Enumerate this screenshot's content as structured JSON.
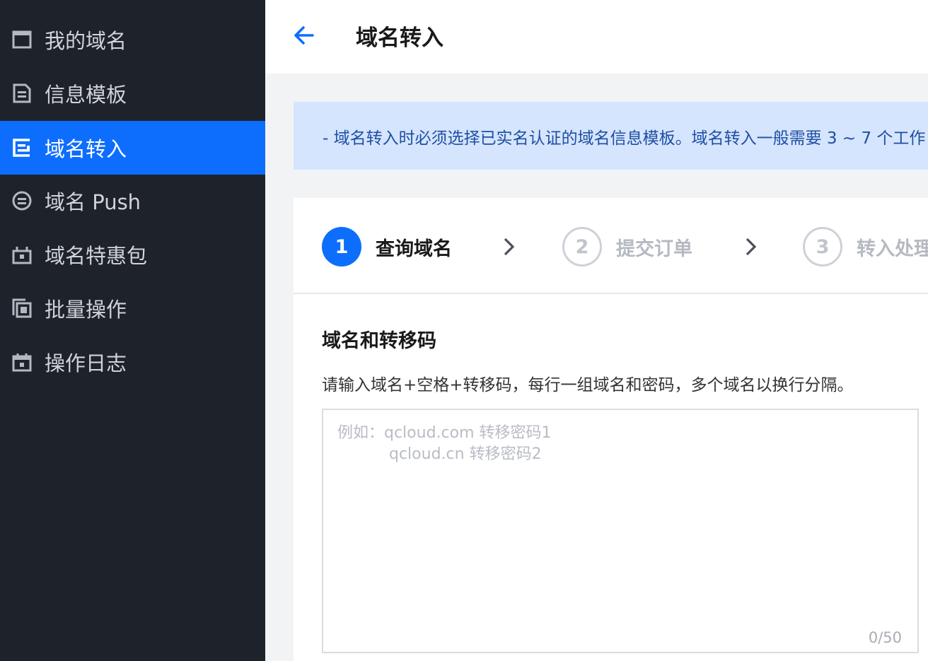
{
  "sidebar": {
    "items": [
      {
        "label": "我的域名",
        "icon": "browser-window-icon",
        "active": false
      },
      {
        "label": "信息模板",
        "icon": "document-icon",
        "active": false
      },
      {
        "label": "域名转入",
        "icon": "transfer-in-icon",
        "active": true
      },
      {
        "label": "域名 Push",
        "icon": "push-circle-icon",
        "active": false
      },
      {
        "label": "域名特惠包",
        "icon": "gift-package-icon",
        "active": false
      },
      {
        "label": "批量操作",
        "icon": "stacked-copies-icon",
        "active": false
      },
      {
        "label": "操作日志",
        "icon": "calendar-log-icon",
        "active": false
      }
    ]
  },
  "header": {
    "back_icon": "arrow-left-icon",
    "title": "域名转入"
  },
  "notice": {
    "text": "- 域名转入时必须选择已实名认证的域名信息模板。域名转入一般需要 3 ~ 7 个工作"
  },
  "steps": [
    {
      "number": "1",
      "label": "查询域名",
      "state": "active"
    },
    {
      "number": "2",
      "label": "提交订单",
      "state": "inactive"
    },
    {
      "number": "3",
      "label": "转入处理",
      "state": "inactive"
    }
  ],
  "form": {
    "section_title": "域名和转移码",
    "description": "请输入域名+空格+转移码，每行一组域名和密码，多个域名以换行分隔。",
    "placeholder_line1": "例如：qcloud.com 转移密码1",
    "placeholder_line2": "qcloud.cn 转移密码2",
    "value": "",
    "counter": "0/50"
  },
  "colors": {
    "sidebar_bg": "#1e222b",
    "accent": "#0d6efd",
    "notice_bg": "#d5e5fe",
    "notice_text": "#1f4ea3"
  }
}
